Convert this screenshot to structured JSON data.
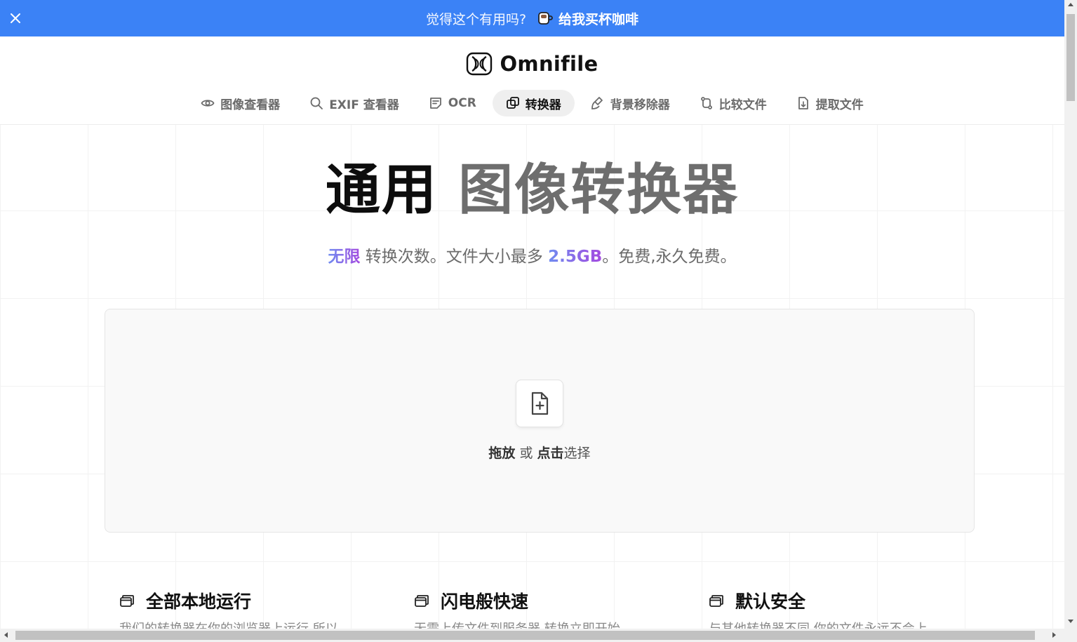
{
  "banner": {
    "close_icon": "close-icon",
    "text": "觉得这个有用吗?",
    "coffee_label": "给我买杯咖啡",
    "coffee_icon": "coffee-cup-icon",
    "bg_color": "#3b82f6"
  },
  "brand": {
    "name": "Omnifile",
    "logo_icon": "omnifile-logo-icon"
  },
  "nav": {
    "items": [
      {
        "label": "图像查看器",
        "icon": "eye-icon",
        "active": false
      },
      {
        "label": "EXIF 查看器",
        "icon": "search-icon",
        "active": false
      },
      {
        "label": "OCR",
        "icon": "document-text-icon",
        "active": false
      },
      {
        "label": "转换器",
        "icon": "convert-icon",
        "active": true
      },
      {
        "label": "背景移除器",
        "icon": "brush-icon",
        "active": false
      },
      {
        "label": "比较文件",
        "icon": "compare-icon",
        "active": false
      },
      {
        "label": "提取文件",
        "icon": "file-extract-icon",
        "active": false
      }
    ]
  },
  "hero": {
    "title_part1": "通用",
    "title_part2": "图像转换器",
    "sub_highlight1": "无限",
    "sub_text1": " 转换次数。文件大小最多 ",
    "sub_highlight2": "2.5GB",
    "sub_text2": "。免费,永久免费。"
  },
  "dropzone": {
    "icon": "file-plus-icon",
    "drag_label": "拖放",
    "or_label": " 或 ",
    "click_label": "点击",
    "select_label": "选择"
  },
  "features": [
    {
      "title": "全部本地运行",
      "icon": "window-stack-icon",
      "desc": "我们的转换器在你的浏览器上运行,所以"
    },
    {
      "title": "闪电般快速",
      "icon": "window-stack-icon",
      "desc": "无需上传文件到服务器,转换立即开始"
    },
    {
      "title": "默认安全",
      "icon": "window-stack-icon",
      "desc": "与其他转换器不同,你的文件永远不会上"
    }
  ]
}
